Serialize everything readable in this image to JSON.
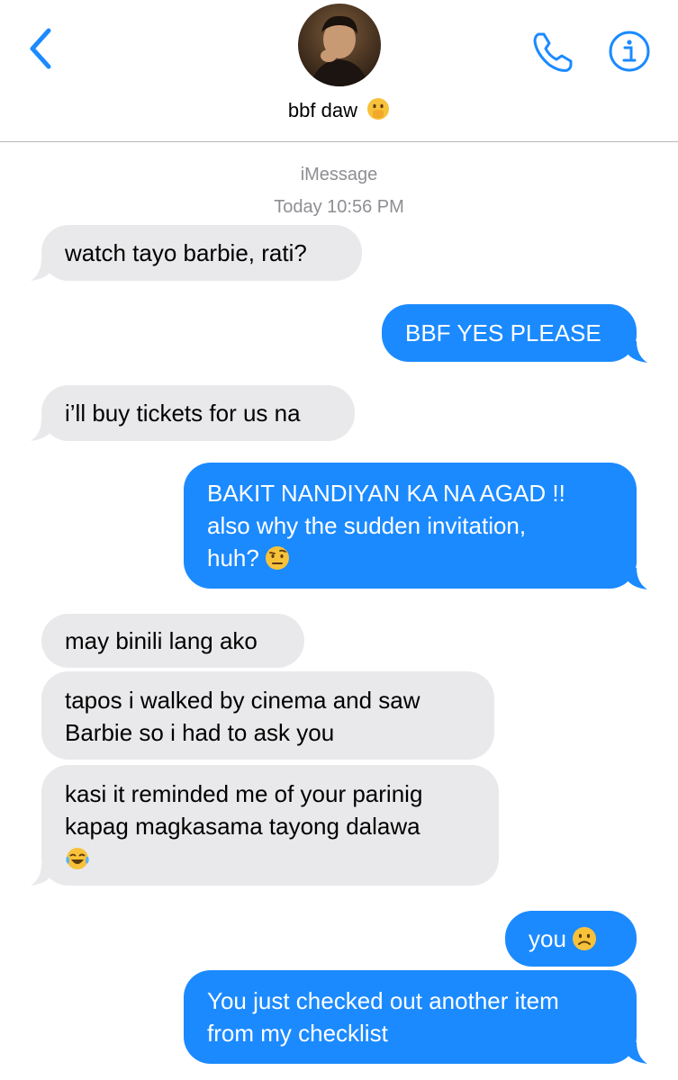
{
  "header": {
    "contact_name": "bbf daw",
    "contact_emoji": "face-with-hand-over-mouth",
    "accent_color": "#1b8aff"
  },
  "meta": {
    "service": "iMessage",
    "timestamp": "Today 10:56 PM"
  },
  "colors": {
    "incoming_bubble": "#e9e9eb",
    "outgoing_bubble": "#1b8aff",
    "meta_text": "#8e8e93"
  },
  "messages": [
    {
      "dir": "in",
      "lines": [
        "watch tayo barbie, rati?"
      ]
    },
    {
      "dir": "out",
      "lines": [
        "BBF YES PLEASE"
      ]
    },
    {
      "dir": "in",
      "lines": [
        "i’ll buy tickets for us na"
      ]
    },
    {
      "dir": "out",
      "lines": [
        "BAKIT NANDIYAN KA NA AGAD !!",
        "also why the sudden invitation,",
        "huh?"
      ],
      "emoji": "face-with-raised-eyebrow"
    },
    {
      "dir": "in",
      "lines": [
        "may binili lang ako"
      ]
    },
    {
      "dir": "in",
      "lines": [
        "tapos i walked by cinema and saw",
        "Barbie so i had to ask you"
      ]
    },
    {
      "dir": "in",
      "lines": [
        "kasi it reminded me of your parinig",
        "kapag magkasama tayong dalawa"
      ],
      "emoji": "face-with-tears-of-joy"
    },
    {
      "dir": "out",
      "lines": [
        "you"
      ],
      "emoji": "frowning-face"
    },
    {
      "dir": "out",
      "lines": [
        "You just checked out another item",
        "from my checklist"
      ]
    }
  ]
}
